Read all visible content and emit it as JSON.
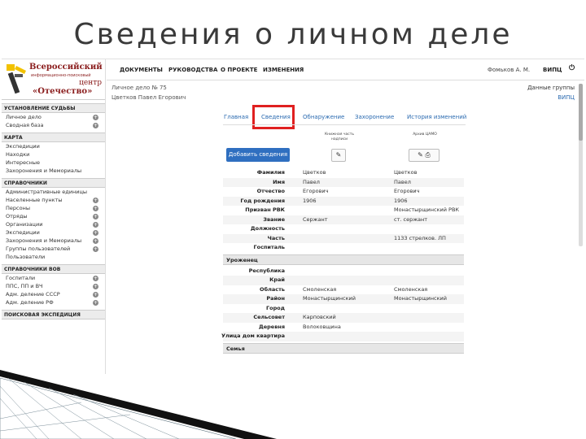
{
  "slide_title": "Сведения о личном деле",
  "logo": {
    "line1": "Всероссийский",
    "line2": "информационно-поисковый",
    "line3": "центр",
    "line4": "«Отечество»"
  },
  "sidebar": {
    "sections": [
      {
        "title": "УСТАНОВЛЕНИЕ СУДЬБЫ",
        "items": [
          {
            "label": "Личное дело",
            "plus": true
          },
          {
            "label": "Сводная база",
            "plus": true
          }
        ]
      },
      {
        "title": "КАРТА",
        "items": [
          {
            "label": "Экспедиции",
            "plus": false
          },
          {
            "label": "Находки",
            "plus": false
          },
          {
            "label": "Интересные",
            "plus": false
          },
          {
            "label": "Захоронения и Мемориалы",
            "plus": false
          }
        ]
      },
      {
        "title": "СПРАВОЧНИКИ",
        "items": [
          {
            "label": "Административные единицы",
            "plus": false
          },
          {
            "label": "Населенные пункты",
            "plus": true
          },
          {
            "label": "Персоны",
            "plus": true
          },
          {
            "label": "Отряды",
            "plus": true
          },
          {
            "label": "Организации",
            "plus": true
          },
          {
            "label": "Экспедиции",
            "plus": true
          },
          {
            "label": "Захоронения и Мемориалы",
            "plus": true
          },
          {
            "label": "Группы пользователей",
            "plus": true
          },
          {
            "label": "Пользователи",
            "plus": false
          }
        ]
      },
      {
        "title": "СПРАВОЧНИКИ ВОВ",
        "items": [
          {
            "label": "Госпитали",
            "plus": true
          },
          {
            "label": "ППС, ПП и ВЧ",
            "plus": true
          },
          {
            "label": "Адм. деление СССР",
            "plus": true
          },
          {
            "label": "Адм. деление РФ",
            "plus": true
          }
        ]
      },
      {
        "title": "ПОИСКОВАЯ ЭКСПЕДИЦИЯ",
        "items": []
      }
    ]
  },
  "topnav": {
    "items": [
      "ДОКУМЕНТЫ",
      "РУКОВОДСТВА",
      "О ПРОЕКТЕ",
      "ИЗМЕНЕНИЯ"
    ],
    "user": "Фомьков А. М.",
    "org": "ВИПЦ"
  },
  "case": {
    "number": "Личное дело № 75",
    "person": "Цветков Павел Егорович",
    "group_label": "Данные группы",
    "group_value": "ВИПЦ"
  },
  "tabs": [
    "Главная",
    "Сведения",
    "Обнаружение",
    "Захоронение",
    "История изменений"
  ],
  "columns": {
    "col1_head": "Книжная часть надписи",
    "col2_head": "Архив ЦАМО"
  },
  "add_button": "Добавить сведения",
  "rows": [
    {
      "label": "Фамилия",
      "v1": "Цветков",
      "v2": "Цветков"
    },
    {
      "label": "Имя",
      "v1": "Павел",
      "v2": "Павел"
    },
    {
      "label": "Отчество",
      "v1": "Егорович",
      "v2": "Егорович"
    },
    {
      "label": "Год рождения",
      "v1": "1906",
      "v2": "1906"
    },
    {
      "label": "Призван РВК",
      "v1": "",
      "v2": "Монастырщинский РВК"
    },
    {
      "label": "Звание",
      "v1": "Сержант",
      "v2": "ст. сержант"
    },
    {
      "label": "Должность",
      "v1": "",
      "v2": ""
    },
    {
      "label": "Часть",
      "v1": "",
      "v2": "1133 стрелков. ЛП"
    },
    {
      "label": "Госпиталь",
      "v1": "",
      "v2": ""
    }
  ],
  "group1": "Уроженец",
  "rows2": [
    {
      "label": "Республика",
      "v1": "",
      "v2": ""
    },
    {
      "label": "Край",
      "v1": "",
      "v2": ""
    },
    {
      "label": "Область",
      "v1": "Смоленская",
      "v2": "Смоленская"
    },
    {
      "label": "Район",
      "v1": "Монастырщинский",
      "v2": "Монастырщинский"
    },
    {
      "label": "Город",
      "v1": "",
      "v2": ""
    },
    {
      "label": "Сельсовет",
      "v1": "Карповский",
      "v2": ""
    },
    {
      "label": "Деревня",
      "v1": "Волоковщина",
      "v2": ""
    },
    {
      "label": "Улица дом квартира",
      "v1": "",
      "v2": ""
    }
  ],
  "group2": "Семья",
  "icons": {
    "edit": "pencil-icon",
    "print": "printer-icon",
    "power": "power-icon"
  }
}
